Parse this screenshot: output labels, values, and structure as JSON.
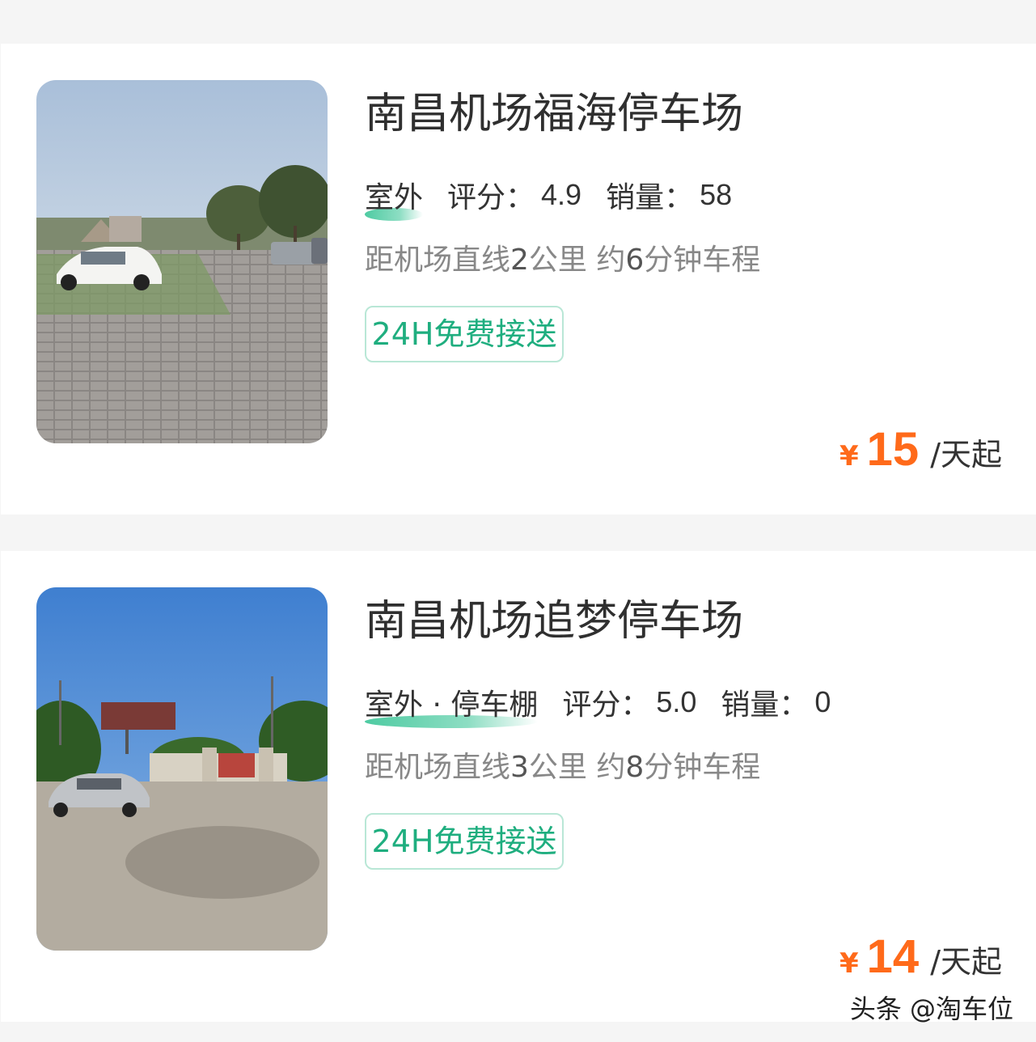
{
  "colors": {
    "page_bg": "#f5f5f5",
    "card_bg": "#ffffff",
    "title": "#2f2f2f",
    "accent_green": "#1fae7f",
    "price_orange": "#ff6a1a",
    "muted_text": "#888888"
  },
  "listings": [
    {
      "name": "南昌机场福海停车场",
      "type": "室外",
      "rating_label": "评分：",
      "rating": "4.9",
      "sales_label": "销量：",
      "sales": "58",
      "distance_prefix": "距机场直线",
      "distance_km": "2",
      "distance_mid": "公里 约",
      "drive_min": "6",
      "distance_suffix": "分钟车程",
      "badge": "24H免费接送",
      "currency": "¥",
      "price": "15",
      "price_unit": "/天起",
      "photo_icon": "parking-lot-photo"
    },
    {
      "name": "南昌机场追梦停车场",
      "type": "室外 · 停车棚",
      "rating_label": "评分：",
      "rating": "5.0",
      "sales_label": "销量：",
      "sales": "0",
      "distance_prefix": "距机场直线",
      "distance_km": "3",
      "distance_mid": "公里 约",
      "drive_min": "8",
      "distance_suffix": "分钟车程",
      "badge": "24H免费接送",
      "currency": "¥",
      "price": "14",
      "price_unit": "/天起",
      "photo_icon": "parking-lot-photo"
    }
  ],
  "watermark": "头条 @淘车位"
}
